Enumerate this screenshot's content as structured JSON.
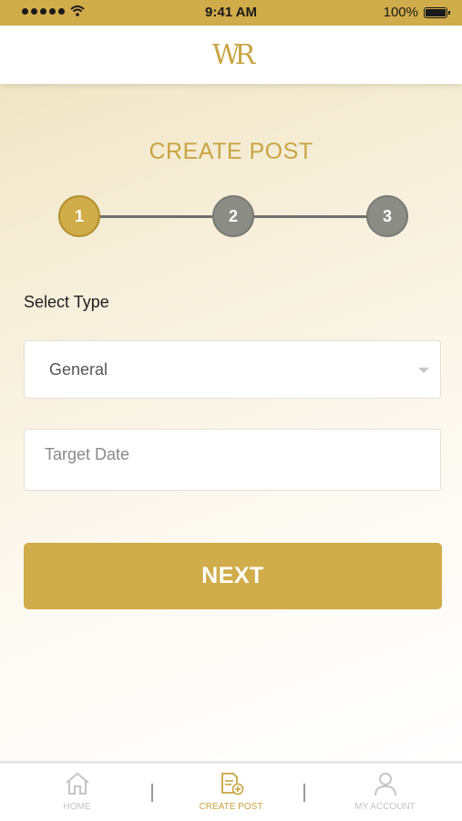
{
  "status_bar": {
    "time": "9:41 AM",
    "battery": "100%"
  },
  "header": {
    "logo_text": "WR"
  },
  "page": {
    "title": "CREATE POST"
  },
  "stepper": {
    "steps": [
      "1",
      "2",
      "3"
    ],
    "current_step": 1
  },
  "form": {
    "select_type_label": "Select Type",
    "select_type_value": "General",
    "target_date_placeholder": "Target Date"
  },
  "next_button": {
    "label": "NEXT"
  },
  "tab_bar": {
    "tabs": [
      {
        "label": "HOME",
        "icon": "home-icon"
      },
      {
        "label": "CREATE POST",
        "icon": "create-post-icon"
      },
      {
        "label": "MY ACCOUNT",
        "icon": "account-icon"
      }
    ],
    "active_tab": "CREATE POST"
  },
  "colors": {
    "accent": "#d1ac4b",
    "title_gold": "#c9a443",
    "inactive_step": "#8c8c87"
  }
}
